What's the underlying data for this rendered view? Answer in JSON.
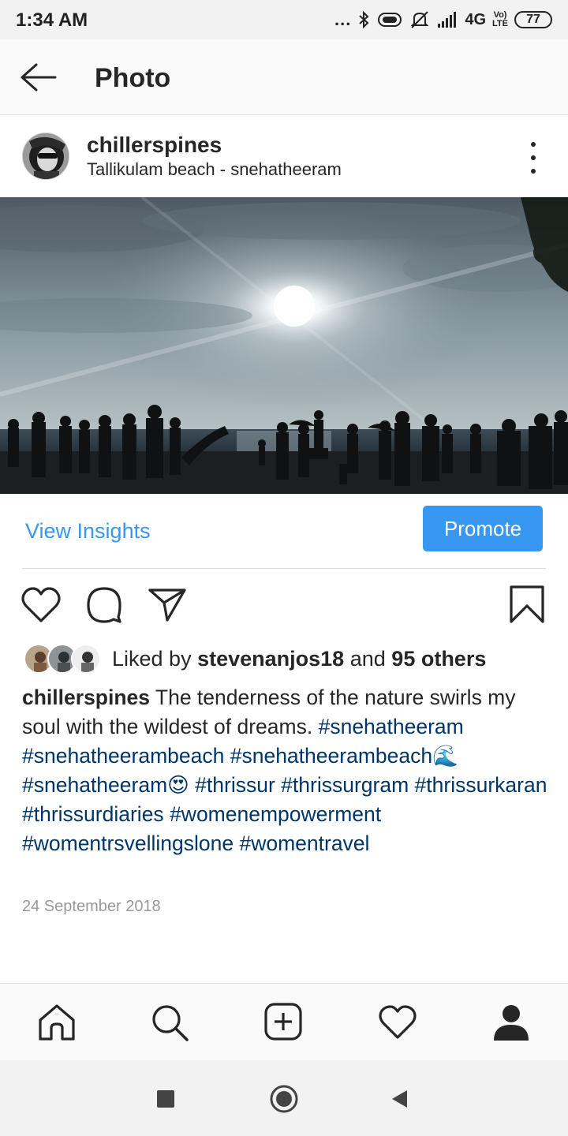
{
  "status_bar": {
    "time": "1:34 AM",
    "dots": "...",
    "network": "4G",
    "lte_top": "Vo)",
    "lte_bottom": "LTE",
    "battery": "77"
  },
  "header": {
    "title": "Photo"
  },
  "post": {
    "username": "chillerspines",
    "location": "Tallikulam beach - snehatheeram"
  },
  "insights": {
    "view_insights": "View Insights",
    "promote": "Promote"
  },
  "likes": {
    "prefix": "Liked by",
    "user": "stevenanjos18",
    "middle": "and",
    "others": "95 others"
  },
  "caption": {
    "username": "chillerspines",
    "text": "The tenderness of the nature swirls my soul with the wildest of dreams.",
    "hashtags": [
      "#snehatheeram",
      "#snehatheerambeach",
      "#snehatheerambeach🌊",
      "#snehatheeram😍",
      "#thrissur",
      "#thrissurgram",
      "#thrissurkaran",
      "#thrissurdiaries",
      "#womenempowerment",
      "#womentrsvellingslone",
      "#womentravel"
    ]
  },
  "date": "24 September 2018",
  "icons": {
    "back": "arrow-left-icon",
    "more": "more-vertical-icon",
    "like": "heart-outline-icon",
    "comment": "comment-icon",
    "share": "paper-plane-icon",
    "save": "bookmark-icon",
    "home": "home-icon",
    "search": "search-icon",
    "add": "plus-square-icon",
    "activity": "heart-icon",
    "profile": "person-icon"
  },
  "colors": {
    "accent": "#3897f0",
    "hashtag": "#003569",
    "date": "#999999"
  }
}
